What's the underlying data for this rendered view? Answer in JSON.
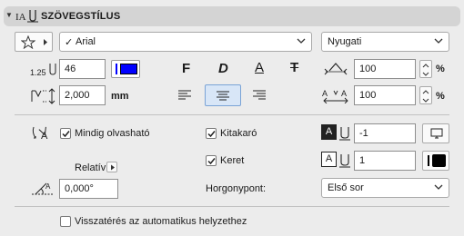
{
  "panel": {
    "title": "SZÖVEGSTÍLUS"
  },
  "font": {
    "name": "Arial",
    "check": "✓",
    "script": "Nyugati"
  },
  "size": {
    "height": "46",
    "spacing": "2,000",
    "spacing_unit": "mm"
  },
  "format": {
    "bold": "F",
    "italic": "D",
    "underline": "A",
    "strike": "T"
  },
  "scale": {
    "width": "100",
    "width_unit": "%",
    "spacing": "100",
    "spacing_unit": "%"
  },
  "options": {
    "always_readable": "Mindig olvasható",
    "fill": "Kitakaró",
    "frame": "Keret",
    "relative": "Relatív",
    "angle": "0,000°",
    "anchor_label": "Horgonypont:",
    "anchor_value": "Első sor",
    "pen_fill": "-1",
    "pen_frame": "1",
    "return_auto": "Visszatérés az automatikus helyzethez"
  },
  "colors": {
    "text_swatch": "#0000ff",
    "frame_swatch": "#000000",
    "selected_bg": "#d8e6f7"
  }
}
